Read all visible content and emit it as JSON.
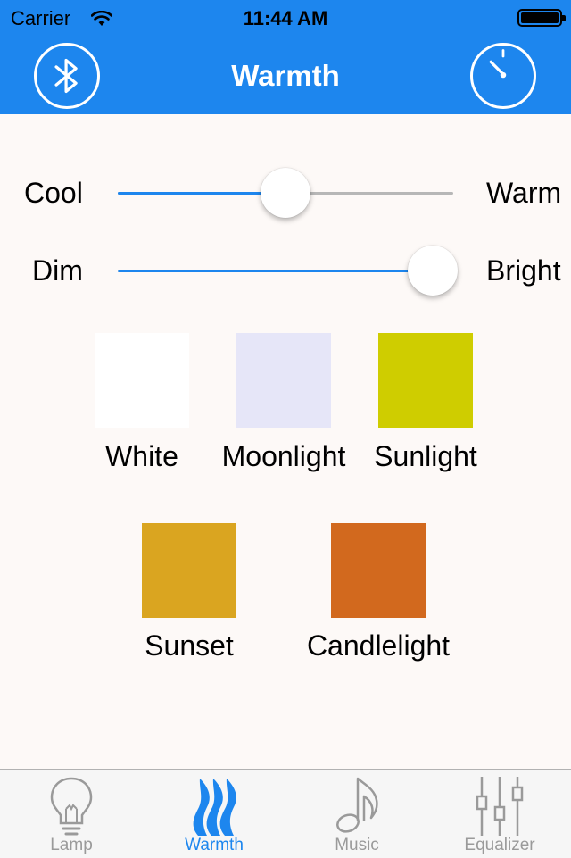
{
  "status_bar": {
    "carrier": "Carrier",
    "time": "11:44 AM"
  },
  "nav": {
    "title": "Warmth",
    "left_icon": "bluetooth-icon",
    "right_icon": "timer-icon"
  },
  "sliders": [
    {
      "left_label": "Cool",
      "right_label": "Warm",
      "value": 0.5
    },
    {
      "left_label": "Dim",
      "right_label": "Bright",
      "value": 0.94
    }
  ],
  "presets": [
    {
      "label": "White",
      "color": "#ffffff"
    },
    {
      "label": "Moonlight",
      "color": "#e6e6f8"
    },
    {
      "label": "Sunlight",
      "color": "#cfcd00"
    },
    {
      "label": "Sunset",
      "color": "#daa520"
    },
    {
      "label": "Candlelight",
      "color": "#d2691e"
    }
  ],
  "tabbar": {
    "items": [
      {
        "label": "Lamp",
        "icon": "lightbulb-icon",
        "active": false
      },
      {
        "label": "Warmth",
        "icon": "flame-icon",
        "active": true
      },
      {
        "label": "Music",
        "icon": "music-note-icon",
        "active": false
      },
      {
        "label": "Equalizer",
        "icon": "equalizer-icon",
        "active": false
      }
    ]
  },
  "colors": {
    "accent": "#1d86ee",
    "inactive": "#9a9a9a"
  }
}
